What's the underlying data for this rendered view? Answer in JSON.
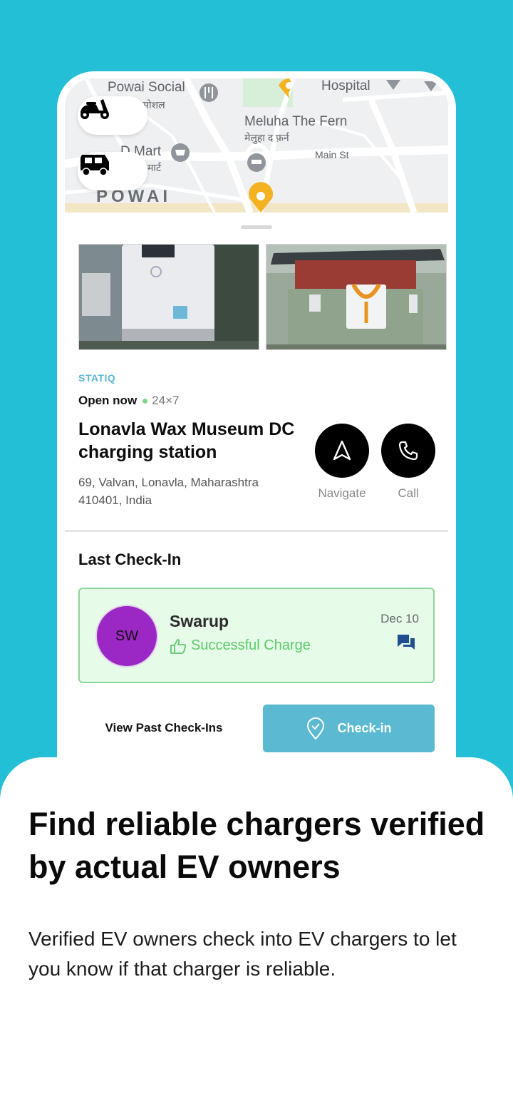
{
  "map": {
    "labels": {
      "powai_social": "Powai Social",
      "powai_social_hi": "पवई सोशल",
      "hospital": "Hospital",
      "meluha": "Meluha The Fern",
      "meluha_hi": "मेलुहा द फ़र्न",
      "dmart": "D Mart",
      "dmart_hi": "मार्ट",
      "main_st": "Main St",
      "area": "POWAI"
    },
    "vehicle_options": [
      "scooter-icon",
      "auto-rickshaw-icon"
    ]
  },
  "station": {
    "brand": "STATIQ",
    "open_status": "Open now",
    "hours": "24×7",
    "name": "Lonavla Wax Museum DC charging station",
    "address": "69, Valvan, Lonavla, Maharashtra 410401, India",
    "actions": {
      "navigate": "Navigate",
      "call": "Call"
    }
  },
  "last_checkin": {
    "title": "Last Check-In",
    "initials": "SW",
    "user": "Swarup",
    "status": "Successful Charge",
    "date": "Dec 10"
  },
  "buttons": {
    "view_past": "View Past Check-Ins",
    "checkin": "Check-in"
  },
  "promo": {
    "headline": "Find reliable chargers verified by actual EV owners",
    "description": "Verified EV owners check into EV chargers to let you know if that charger is reliable."
  },
  "colors": {
    "background": "#22bfd6",
    "brand_accent": "#5bbad1",
    "success": "#5bc96a",
    "avatar": "#9b27c4",
    "map_pin": "#f4b223"
  }
}
